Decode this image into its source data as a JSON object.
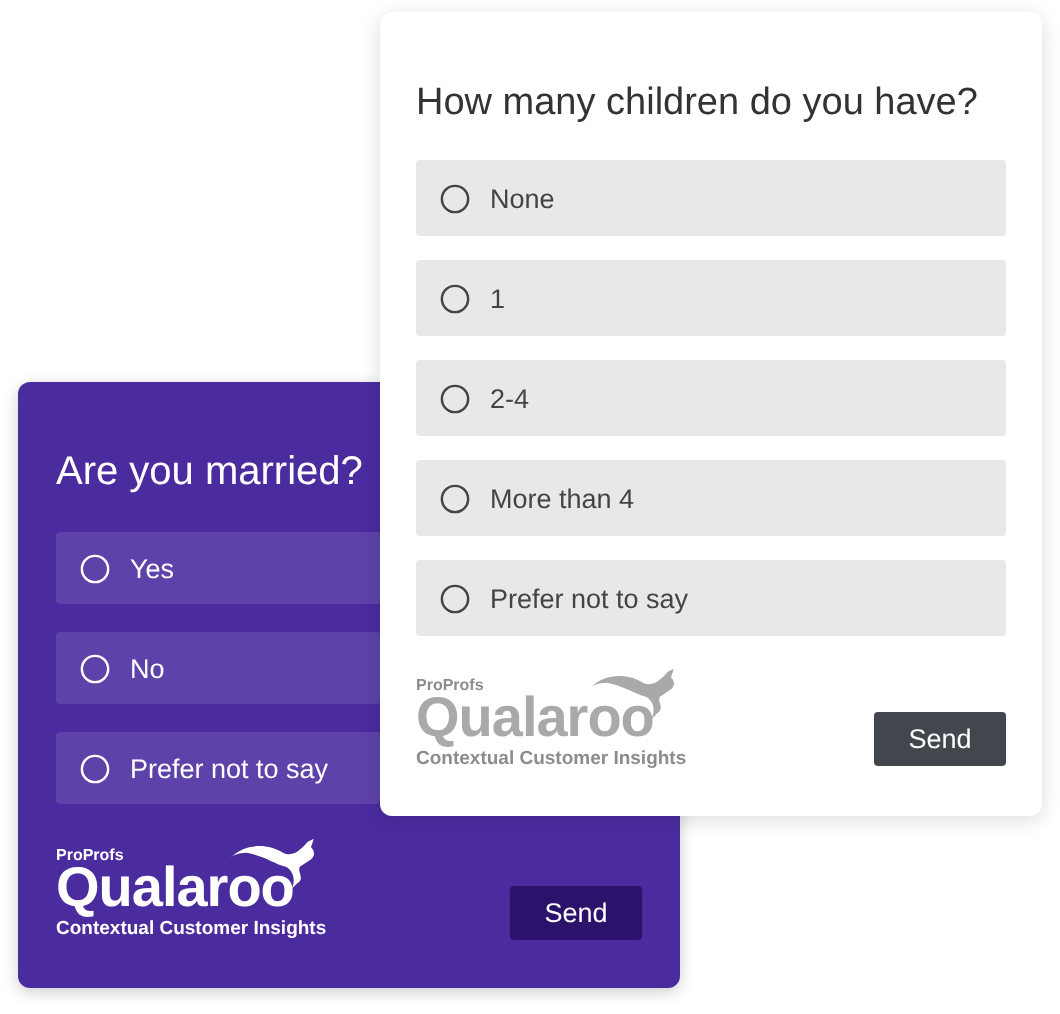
{
  "surveys": [
    {
      "kind": "light",
      "question": "How many children do you have?",
      "options": [
        {
          "label": "None",
          "selected": false
        },
        {
          "label": "1",
          "selected": false
        },
        {
          "label": "2-4",
          "selected": false
        },
        {
          "label": "More than 4",
          "selected": false
        },
        {
          "label": "Prefer not to say",
          "selected": false
        }
      ],
      "logo": {
        "brand_small": "ProProfs",
        "brand": "Qualaroo",
        "tagline": "Contextual Customer Insights"
      },
      "button": "Send"
    },
    {
      "kind": "dark",
      "question": "Are you married?",
      "options": [
        {
          "label": "Yes",
          "selected": false
        },
        {
          "label": "No",
          "selected": false
        },
        {
          "label": "Prefer not to say",
          "selected": false
        }
      ],
      "logo": {
        "brand_small": "ProProfs",
        "brand": "Qualaroo",
        "tagline": "Contextual Customer Insights"
      },
      "button": "Send"
    }
  ]
}
